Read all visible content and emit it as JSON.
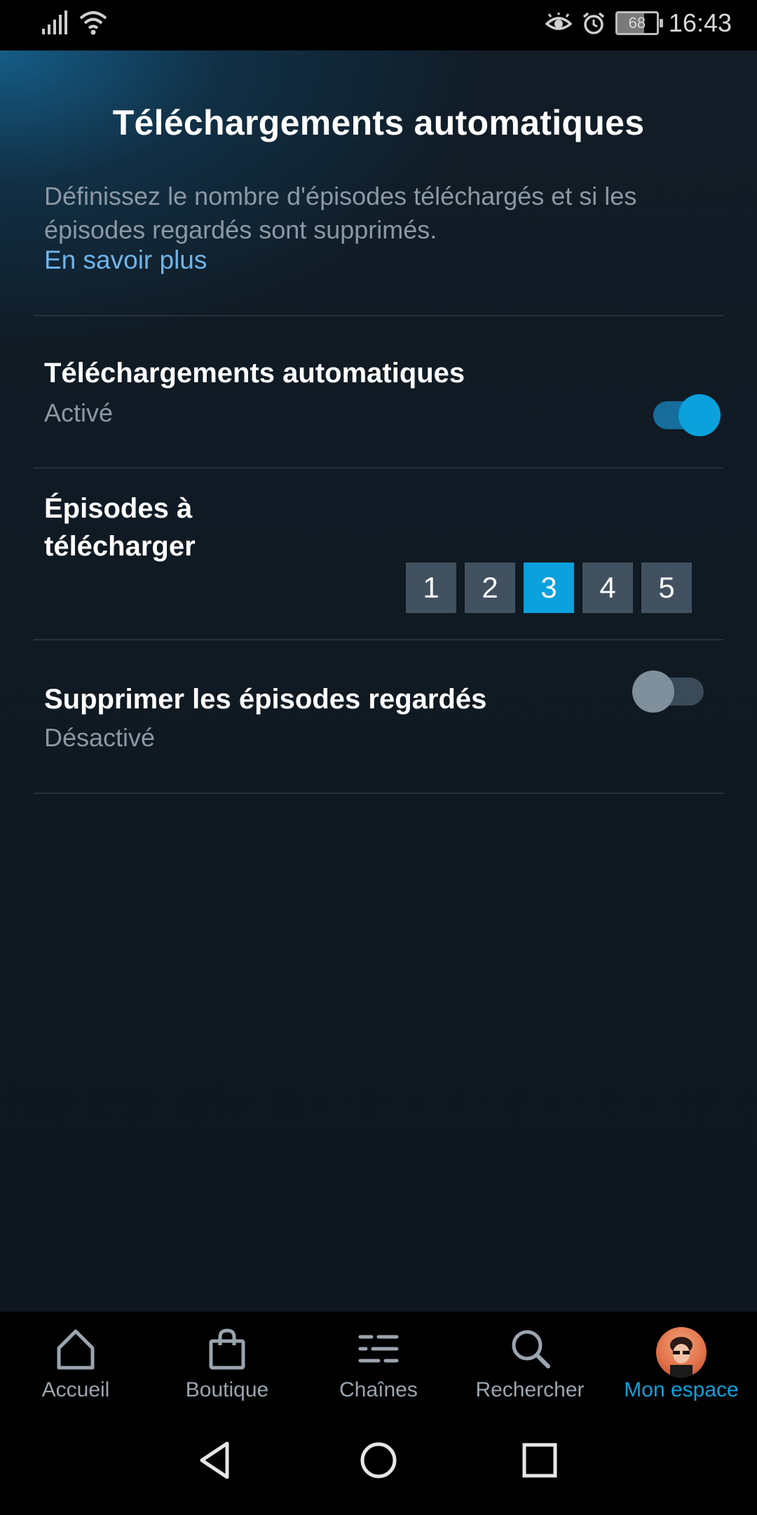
{
  "status_bar": {
    "time": "16:43",
    "battery_level": "68",
    "icons": [
      "signal-icon",
      "wifi-icon",
      "eye-comfort-icon",
      "alarm-icon",
      "battery-icon"
    ]
  },
  "page": {
    "title": "Téléchargements automatiques",
    "description": "Définissez le nombre d'épisodes téléchargés et si les épisodes regardés sont supprimés.",
    "learn_more": "En savoir plus"
  },
  "settings": {
    "auto_download": {
      "title": "Téléchargements automatiques",
      "status": "Activé",
      "enabled": true
    },
    "episodes": {
      "title": "Épisodes à télécharger",
      "options": [
        "1",
        "2",
        "3",
        "4",
        "5"
      ],
      "selected": "3"
    },
    "delete_watched": {
      "title": "Supprimer les épisodes regardés",
      "status": "Désactivé",
      "enabled": false
    }
  },
  "bottom_nav": {
    "items": [
      {
        "label": "Accueil",
        "icon": "home-icon"
      },
      {
        "label": "Boutique",
        "icon": "shopping-bag-icon"
      },
      {
        "label": "Chaînes",
        "icon": "channels-icon"
      },
      {
        "label": "Rechercher",
        "icon": "search-icon"
      },
      {
        "label": "Mon espace",
        "icon": "avatar",
        "active": true
      }
    ]
  },
  "system_nav": {
    "icons": [
      "back-icon",
      "home-circle-icon",
      "recents-icon"
    ]
  },
  "colors": {
    "accent": "#0aa1dd",
    "link": "#6fb5ea",
    "background": "#0f171f",
    "secondary_text": "#8b98a4"
  }
}
